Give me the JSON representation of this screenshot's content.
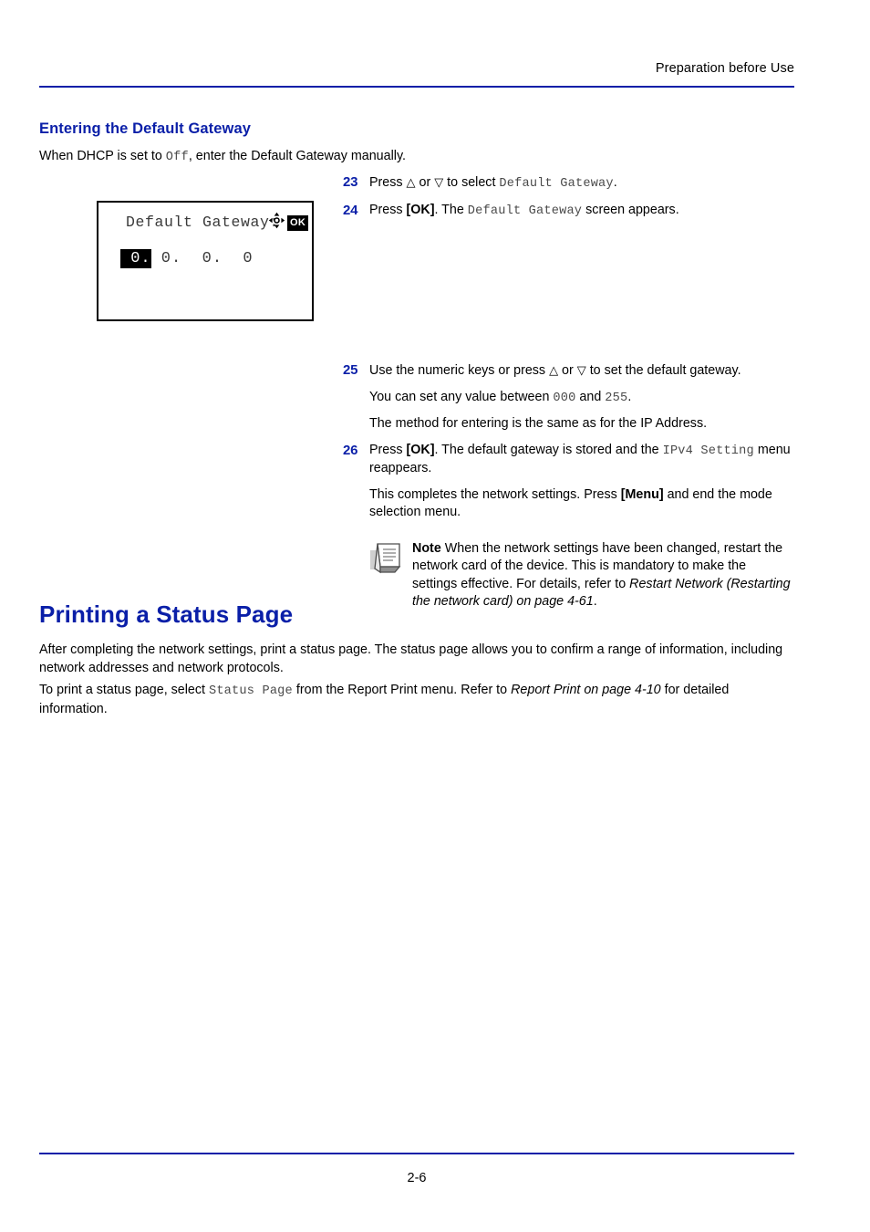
{
  "header": {
    "running_head": "Preparation before Use"
  },
  "section": {
    "heading": "Entering the Default Gateway",
    "intro_before": "When DHCP is set to ",
    "intro_mono": "Off",
    "intro_after": ", enter the Default Gateway manually."
  },
  "lcd": {
    "title": "Default Gateway:",
    "dpad_icon": "four-way-arrow-icon",
    "ok_badge": "OK",
    "value_selected": " 0.",
    "value_rest": " 0.  0.  0"
  },
  "steps": [
    {
      "number": "23",
      "text_1": "Press ",
      "up_arrow": "△",
      "text_2": " or ",
      "down_arrow": "▽",
      "text_3": " to select ",
      "mono_1": "Default Gateway",
      "text_4": "."
    },
    {
      "number": "24",
      "text_1": "Press ",
      "bold_1": "[OK]",
      "text_2": ". The ",
      "mono_1": "Default Gateway",
      "text_3": " screen appears."
    },
    {
      "number": "25",
      "text_1": "Use the numeric keys or press ",
      "up_arrow": "△",
      "text_2": " or ",
      "down_arrow": "▽",
      "text_3": " to set the default gateway.",
      "sub_1_a": "You can set any value between ",
      "sub_1_mono_1": "000",
      "sub_1_b": " and ",
      "sub_1_mono_2": "255",
      "sub_1_c": ".",
      "sub_2": "The method for entering is the same as for the IP Address."
    },
    {
      "number": "26",
      "text_1": "Press ",
      "bold_1": "[OK]",
      "text_2": ". The default gateway is stored and the ",
      "mono_1": "IPv4 Setting",
      "text_3": " menu reappears.",
      "sub_1_a": "This completes the network settings. Press ",
      "sub_1_bold": "[Menu]",
      "sub_1_b": " and end the mode selection menu."
    }
  ],
  "note": {
    "icon": "note-document-icon",
    "label": "Note",
    "text_1": "  When the network settings have been changed, restart the network card of the device. This is mandatory to make the settings effective. For details, refer to ",
    "italic_1": "Restart Network (Restarting the network card) on page 4-61",
    "text_2": "."
  },
  "status_page": {
    "heading": "Printing a Status Page",
    "paragraph_1": "After completing the network settings, print a status page. The status page allows you to confirm a range of information, including network addresses and network protocols.",
    "paragraph_2_a": "To print a status page, select ",
    "paragraph_2_mono": "Status Page",
    "paragraph_2_b": " from the Report Print menu. Refer to ",
    "paragraph_2_italic": "Report Print on page 4-10",
    "paragraph_2_c": " for detailed information."
  },
  "footer": {
    "page_number": "2-6"
  },
  "colors": {
    "accent_blue": "#0a1fa8",
    "body_text": "#000000",
    "mono_text": "#4a4a4a"
  }
}
